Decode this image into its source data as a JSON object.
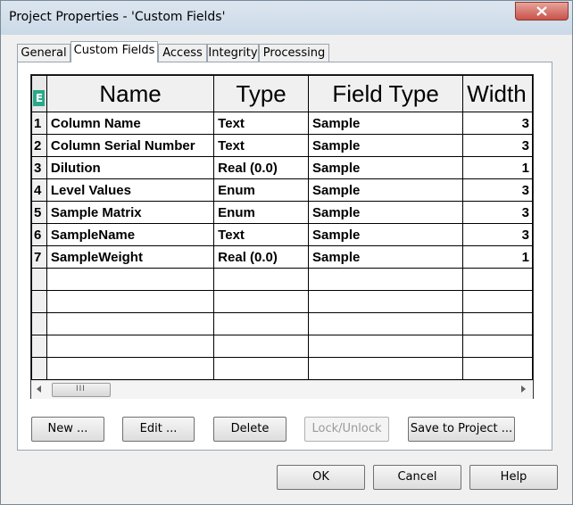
{
  "window": {
    "title": "Project Properties - 'Custom Fields'"
  },
  "tabs": [
    {
      "label": "General"
    },
    {
      "label": "Custom Fields"
    },
    {
      "label": "Access"
    },
    {
      "label": "Integrity"
    },
    {
      "label": "Processing"
    }
  ],
  "grid": {
    "corner_icon_label": "E",
    "columns": [
      "Name",
      "Type",
      "Field Type",
      "Width"
    ],
    "rows": [
      {
        "num": "1",
        "name": "Column Name",
        "type": "Text",
        "field_type": "Sample",
        "width": "3"
      },
      {
        "num": "2",
        "name": "Column Serial Number",
        "type": "Text",
        "field_type": "Sample",
        "width": "3"
      },
      {
        "num": "3",
        "name": "Dilution",
        "type": "Real (0.0)",
        "field_type": "Sample",
        "width": "1"
      },
      {
        "num": "4",
        "name": "Level Values",
        "type": "Enum",
        "field_type": "Sample",
        "width": "3"
      },
      {
        "num": "5",
        "name": "Sample Matrix",
        "type": "Enum",
        "field_type": "Sample",
        "width": "3"
      },
      {
        "num": "6",
        "name": "SampleName",
        "type": "Text",
        "field_type": "Sample",
        "width": "3"
      },
      {
        "num": "7",
        "name": "SampleWeight",
        "type": "Real (0.0)",
        "field_type": "Sample",
        "width": "1"
      }
    ],
    "scroll_thumb_grip": "III"
  },
  "actions": {
    "new": "New ...",
    "edit": "Edit ...",
    "delete": "Delete",
    "lock_unlock": "Lock/Unlock",
    "save_to_project": "Save to Project ..."
  },
  "footer": {
    "ok": "OK",
    "cancel": "Cancel",
    "help": "Help"
  }
}
